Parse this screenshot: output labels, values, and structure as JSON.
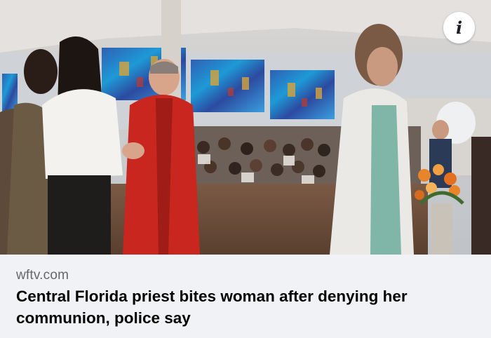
{
  "link_preview": {
    "domain": "wftv.com",
    "headline": "Central Florida priest bites woman after denying her communion, police say",
    "info_icon": "info-icon",
    "image_subject": "priest in red vestments giving communion in a church with stained glass windows"
  },
  "colors": {
    "background": "#f0f2f5",
    "domain_text": "#65676b",
    "headline_text": "#050505",
    "vestment_red": "#c8261f"
  }
}
